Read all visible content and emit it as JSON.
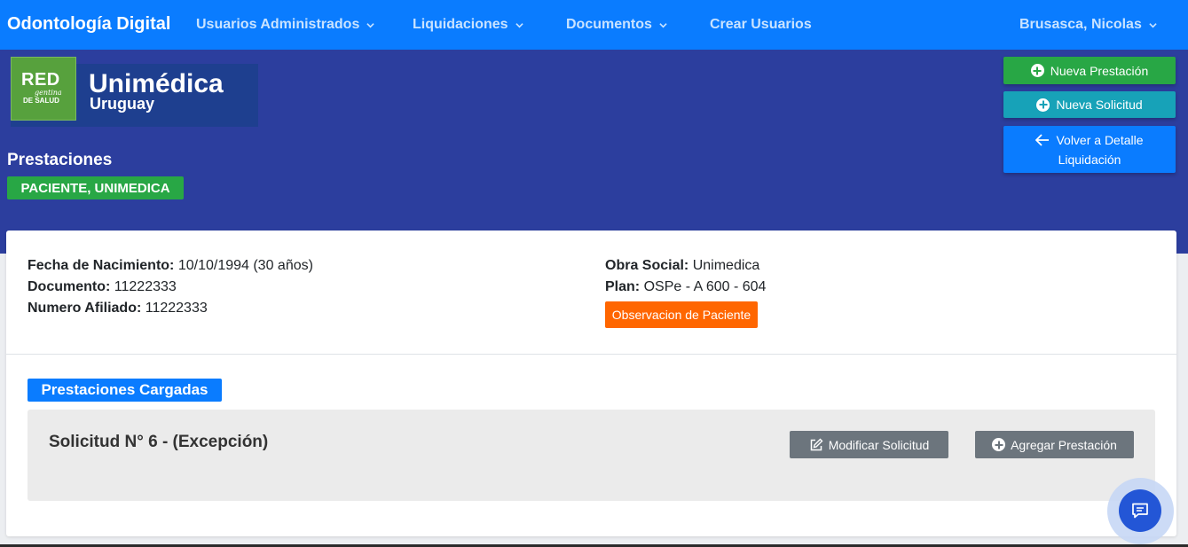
{
  "navbar": {
    "brand": "Odontología Digital",
    "items": [
      {
        "label": "Usuarios Administrados",
        "dropdown": true
      },
      {
        "label": "Liquidaciones",
        "dropdown": true
      },
      {
        "label": "Documentos",
        "dropdown": true
      },
      {
        "label": "Crear Usuarios",
        "dropdown": false
      }
    ],
    "user": {
      "label": "Brusasca, Nicolas",
      "dropdown": true
    }
  },
  "logo": {
    "red": "RED",
    "gentina": "gentina",
    "salud": "DE SALUD",
    "name": "Unimédica",
    "country": "Uruguay"
  },
  "page": {
    "title": "Prestaciones",
    "patient_badge": "PACIENTE, UNIMEDICA"
  },
  "actions": {
    "nueva_prestacion": "Nueva Prestación",
    "nueva_solicitud": "Nueva Solicitud",
    "volver_line1": "Volver a Detalle",
    "volver_line2": "Liquidación"
  },
  "patient": {
    "fecha_nacimiento_label": "Fecha de Nacimiento:",
    "fecha_nacimiento_value": "10/10/1994 (30 años)",
    "documento_label": "Documento:",
    "documento_value": "11222333",
    "afiliado_label": "Numero Afiliado:",
    "afiliado_value": "11222333",
    "obra_social_label": "Obra Social:",
    "obra_social_value": "Unimedica",
    "plan_label": "Plan:",
    "plan_value": "OSPe - A 600 - 604",
    "observacion_button": "Observacion de Paciente"
  },
  "prestaciones": {
    "section_title": "Prestaciones Cargadas",
    "solicitud_title": "Solicitud N° 6 - (Excepción)",
    "modificar_button": "Modificar Solicitud",
    "agregar_button": "Agregar Prestación"
  },
  "colors": {
    "navbar": "#0a7cff",
    "hero": "#2c3e9e",
    "success": "#28a745",
    "info": "#17a2b8",
    "warning": "#ff6600",
    "secondary": "#6c757d",
    "chat": "#2356d6"
  }
}
